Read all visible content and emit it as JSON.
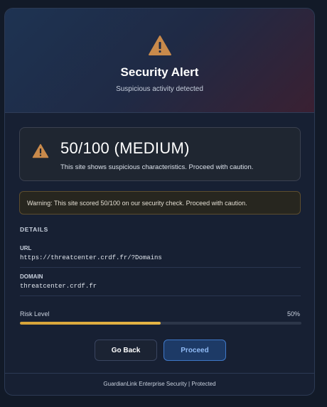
{
  "header": {
    "title": "Security Alert",
    "subtitle": "Suspicious activity detected"
  },
  "score": {
    "value": "50/100 (MEDIUM)",
    "description": "This site shows suspicious characteristics. Proceed with caution."
  },
  "warning": {
    "text": "Warning: This site scored 50/100 on our security check. Proceed with caution."
  },
  "details": {
    "heading": "DETAILS",
    "url_label": "URL",
    "url_value": "https://threatcenter.crdf.fr/?Domains",
    "domain_label": "DOMAIN",
    "domain_value": "threatcenter.crdf.fr"
  },
  "risk": {
    "label": "Risk Level",
    "value_text": "50%",
    "level": 0.5
  },
  "actions": {
    "back_label": "Go Back",
    "proceed_label": "Proceed"
  },
  "footer": {
    "text": "GuardianLink Enterprise Security | Protected"
  },
  "colors": {
    "warning_icon": "#c98a4b",
    "risk_fill": "#d6a33a",
    "proceed_accent": "#3f78c8"
  },
  "icons": {
    "header": "warning-triangle-icon",
    "score": "warning-triangle-icon"
  }
}
